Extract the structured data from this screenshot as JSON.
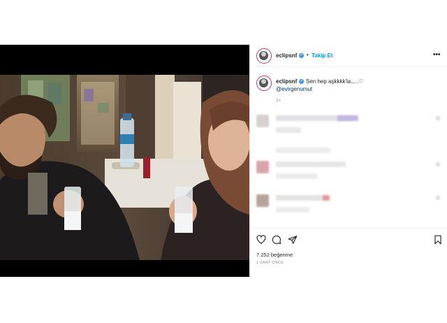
{
  "post": {
    "username": "eclipsnf",
    "follow_label": "Takip Et",
    "separator": "•",
    "more_label": "•••",
    "caption": "Sen hep aşkkkk'la.....♡",
    "mention": "@evirgenumut",
    "caption_time": "1s",
    "likes": "7.252 beğenme",
    "post_time": "1 SAAT ÖNCE"
  },
  "icons": {
    "like": "heart-icon",
    "comment": "comment-icon",
    "share": "share-icon",
    "save": "bookmark-icon",
    "verified": "verified-badge-icon"
  },
  "colors": {
    "follow": "#0095f6",
    "verified": "#3897f0",
    "avatar_ring": "#c13584"
  }
}
